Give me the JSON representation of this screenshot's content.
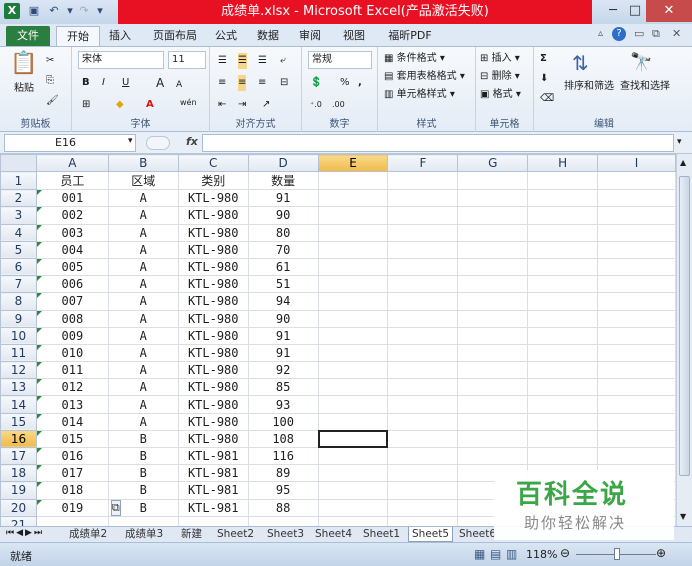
{
  "window": {
    "title": "成绩单.xlsx - Microsoft Excel(产品激活失败)",
    "minimize": "─",
    "maximize": "□",
    "close": "✕"
  },
  "tabs": [
    {
      "label": "文件"
    },
    {
      "label": "开始"
    },
    {
      "label": "插入"
    },
    {
      "label": "页面布局"
    },
    {
      "label": "公式"
    },
    {
      "label": "数据"
    },
    {
      "label": "审阅"
    },
    {
      "label": "视图"
    },
    {
      "label": "福昕PDF"
    }
  ],
  "ribbon": {
    "clipboard": {
      "label": "剪贴板",
      "paste": "粘贴"
    },
    "font": {
      "label": "字体",
      "name": "宋体",
      "size": "11",
      "bold": "B",
      "italic": "I",
      "underline": "U",
      "grow": "A",
      "shrink": "A",
      "wen": "wén"
    },
    "alignment": {
      "label": "对齐方式"
    },
    "number": {
      "label": "数字",
      "format": "常规",
      "percent": "%",
      "comma": ","
    },
    "styles": {
      "label": "样式",
      "conditional": "条件格式",
      "table": "套用表格格式",
      "cell": "单元格样式"
    },
    "cells": {
      "label": "单元格",
      "insert": "插入",
      "delete": "删除",
      "format": "格式"
    },
    "editing": {
      "label": "编辑",
      "sort": "排序和筛选",
      "find": "查找和选择",
      "sigma": "Σ"
    }
  },
  "formula_bar": {
    "name_box": "E16",
    "fx": "fx",
    "value": ""
  },
  "grid": {
    "columns": [
      "A",
      "B",
      "C",
      "D",
      "E",
      "F",
      "G",
      "H",
      "I"
    ],
    "selected_column": "E",
    "selected_row": "16",
    "rows": [
      {
        "n": "1",
        "a": "员工",
        "b": "区域",
        "c": "类别",
        "d": "数量"
      },
      {
        "n": "2",
        "a": "001",
        "b": "A",
        "c": "KTL-980",
        "d": "91"
      },
      {
        "n": "3",
        "a": "002",
        "b": "A",
        "c": "KTL-980",
        "d": "90"
      },
      {
        "n": "4",
        "a": "003",
        "b": "A",
        "c": "KTL-980",
        "d": "80"
      },
      {
        "n": "5",
        "a": "004",
        "b": "A",
        "c": "KTL-980",
        "d": "70"
      },
      {
        "n": "6",
        "a": "005",
        "b": "A",
        "c": "KTL-980",
        "d": "61"
      },
      {
        "n": "7",
        "a": "006",
        "b": "A",
        "c": "KTL-980",
        "d": "51"
      },
      {
        "n": "8",
        "a": "007",
        "b": "A",
        "c": "KTL-980",
        "d": "94"
      },
      {
        "n": "9",
        "a": "008",
        "b": "A",
        "c": "KTL-980",
        "d": "90"
      },
      {
        "n": "10",
        "a": "009",
        "b": "A",
        "c": "KTL-980",
        "d": "91"
      },
      {
        "n": "11",
        "a": "010",
        "b": "A",
        "c": "KTL-980",
        "d": "91"
      },
      {
        "n": "12",
        "a": "011",
        "b": "A",
        "c": "KTL-980",
        "d": "92"
      },
      {
        "n": "13",
        "a": "012",
        "b": "A",
        "c": "KTL-980",
        "d": "85"
      },
      {
        "n": "14",
        "a": "013",
        "b": "A",
        "c": "KTL-980",
        "d": "93"
      },
      {
        "n": "15",
        "a": "014",
        "b": "A",
        "c": "KTL-980",
        "d": "100"
      },
      {
        "n": "16",
        "a": "015",
        "b": "B",
        "c": "KTL-980",
        "d": "108"
      },
      {
        "n": "17",
        "a": "016",
        "b": "B",
        "c": "KTL-981",
        "d": "116"
      },
      {
        "n": "18",
        "a": "017",
        "b": "B",
        "c": "KTL-981",
        "d": "89"
      },
      {
        "n": "19",
        "a": "018",
        "b": "B",
        "c": "KTL-981",
        "d": "95"
      },
      {
        "n": "20",
        "a": "019",
        "b": "B",
        "c": "KTL-981",
        "d": "88"
      },
      {
        "n": "21",
        "a": "",
        "b": "",
        "c": "",
        "d": ""
      }
    ]
  },
  "sheet_tabs": [
    "成绩单2",
    "成绩单3",
    "新建",
    "Sheet2",
    "Sheet3",
    "Sheet4",
    "Sheet1",
    "Sheet5",
    "Sheet6"
  ],
  "active_sheet": "Sheet5",
  "status": {
    "ready": "就绪",
    "zoom": "118%"
  },
  "watermark": {
    "line1": "百科全说",
    "line2": "助你轻松解决"
  },
  "colors": {
    "file_tab": "#2a7e3f",
    "title_red": "#e81123",
    "selection": "#f0bb4a"
  }
}
